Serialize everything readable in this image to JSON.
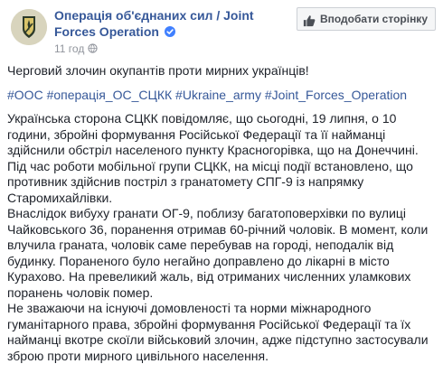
{
  "page": {
    "name": "Операція об'єднаних сил / Joint Forces Operation",
    "timestamp": "11 год",
    "like_button_label": "Вподобати сторінку"
  },
  "post": {
    "title": "Черговий злочин окупантів проти мирних українців!",
    "hashtags": [
      "#ООС",
      "#операція_ОС_СЦКК",
      "#Ukraine_army",
      "#Joint_Forces_Operation"
    ],
    "paragraphs": [
      "Українська сторона СЦКК повідомляє, що сьогодні, 19 липня, о 10 години, збройні формування Російської Федерації та її найманці здійснили обстріл населеного пункту Красногорівка, що на Донеччині. Під час роботи мобільної групи СЦКК, на місці події встановлено, що противник здійснив постріл з гранатомету СПГ-9 із напрямку Старомихайлівки.",
      "Внаслідок вибуху гранати ОГ-9, поблизу багатоповерхівки по вулиці Чайковського 36, поранення отримав 60-річний чоловік. В момент, коли влучила граната, чоловік саме перебував на городі, неподалік від будинку. Пораненого було негайно доправлено до лікарні в місто Курахово. На превеликий жаль, від отриманих численних уламкових поранень чоловік помер.",
      "Не зважаючи на існуючі домовленості та норми міжнародного гуманітарного права, збройні формування Російської Федерації та їх найманці вкотре скоїли військовий злочин, адже підступно застосували зброю проти мирного цивільного населення."
    ]
  },
  "colors": {
    "link": "#365899",
    "text": "#1d2129",
    "meta": "#90949c",
    "verified": "#4080ff"
  },
  "icons": {
    "avatar": "joint-forces-emblem",
    "verified": "verified-badge-icon",
    "privacy": "globe-icon",
    "like": "thumbs-up-icon"
  }
}
